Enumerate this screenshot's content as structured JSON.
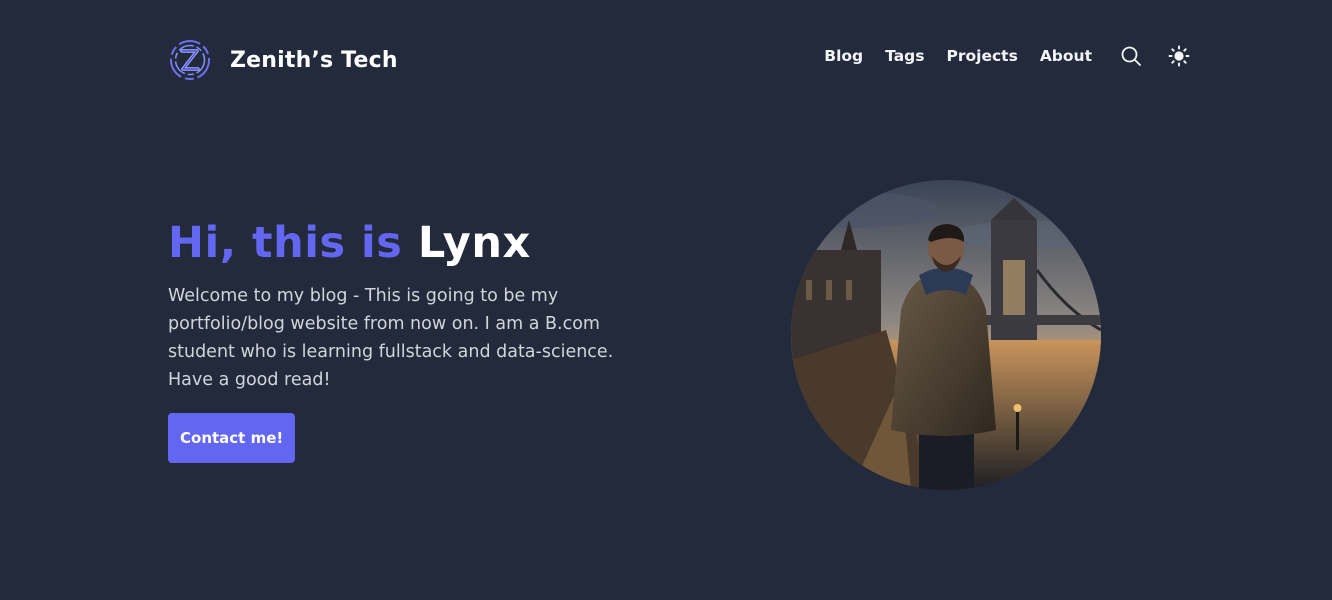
{
  "header": {
    "brand_name": "Zenith’s Tech",
    "logo_icon": "z-logo-icon",
    "nav": [
      {
        "label": "Blog"
      },
      {
        "label": "Tags"
      },
      {
        "label": "Projects"
      },
      {
        "label": "About"
      }
    ],
    "search_icon": "search-icon",
    "theme_icon": "sun-icon"
  },
  "hero": {
    "greeting": "Hi, this is",
    "name": "Lynx",
    "intro": "Welcome to my blog - This is going to be my portfolio/blog website from now on. I am a B.com student who is learning fullstack and data-science. Have a good read!",
    "cta_label": "Contact me!"
  },
  "colors": {
    "background": "#222a3b",
    "accent": "#6366f1",
    "heading": "#ffffff",
    "body_text": "#d1d5db"
  }
}
